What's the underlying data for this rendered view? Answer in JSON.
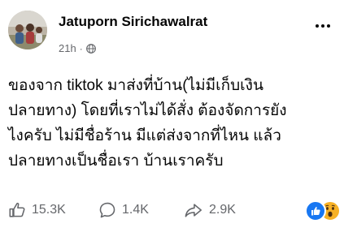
{
  "post": {
    "author": "Jatuporn Sirichawalrat",
    "time": "21h",
    "separator": "·",
    "privacy_icon": "globe-icon",
    "more_icon": "more-options-icon",
    "text": "ของจาก tiktok มาส่งที่บ้าน(ไม่มีเก็บเงิน\nปลายทาง) โดยที่เราไม่ได้สั่ง ต้องจัดการยัง\nไงครับ ไม่มีชื่อร้าน มีแต่ส่งจากที่ไหน แล้ว\nปลายทางเป็นชื่อเรา บ้านเราครับ"
  },
  "stats": {
    "likes": "15.3K",
    "comments": "1.4K",
    "shares": "2.9K"
  },
  "reactions": [
    "like-reaction-icon",
    "wow-reaction-icon"
  ],
  "colors": {
    "text_primary": "#050505",
    "text_secondary": "#65676b",
    "like_blue": "#1877f2",
    "wow_yellow": "#f7b125"
  }
}
